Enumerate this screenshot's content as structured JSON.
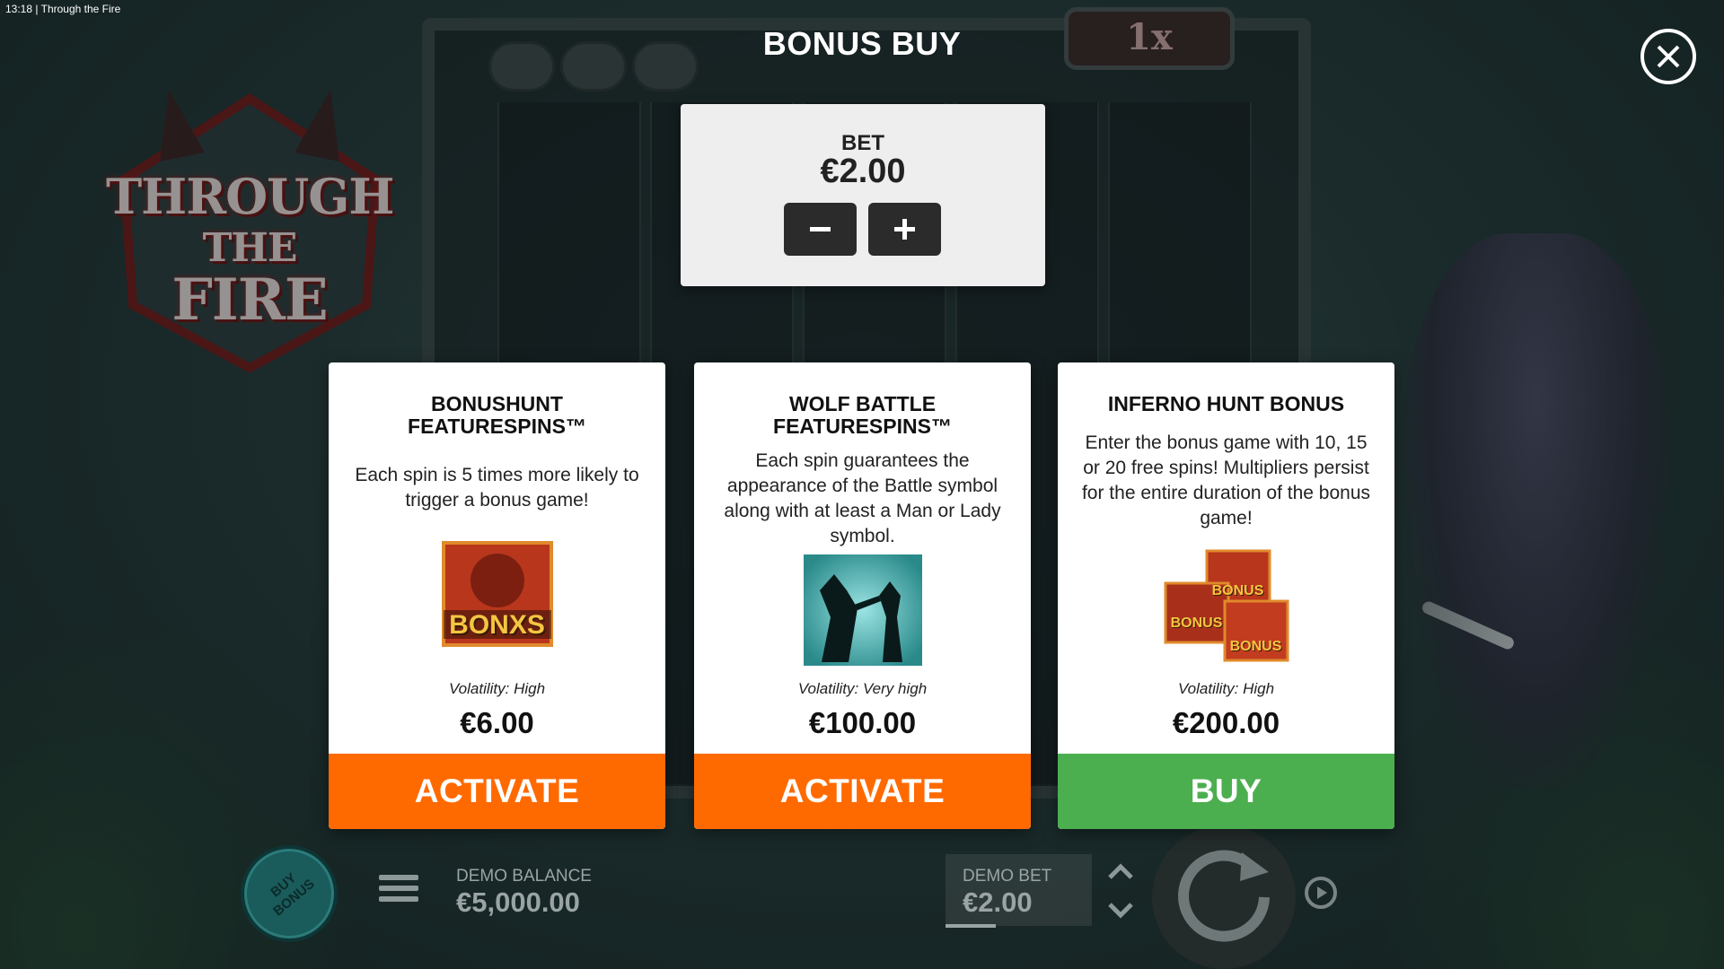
{
  "status": {
    "time": "13:18",
    "separator": "|",
    "title": "Through the Fire"
  },
  "logo": {
    "line1": "THROUGH",
    "line2": "THE",
    "line3": "FIRE"
  },
  "multiplier": "1x",
  "modal": {
    "title": "BONUS BUY",
    "close_icon": "close-icon",
    "bet": {
      "label": "BET",
      "value": "€2.00",
      "decrease_icon": "minus-icon",
      "increase_icon": "plus-icon"
    },
    "cards": [
      {
        "title_line1": "BONUSHUNT",
        "title_line2": "FEATURESPINS™",
        "description": "Each spin is 5 times more likely to trigger a bonus game!",
        "volatility": "Volatility: High",
        "price": "€6.00",
        "action": "ACTIVATE",
        "action_color": "#ff6a00",
        "image_text": "BONXS"
      },
      {
        "title_line1": "WOLF BATTLE",
        "title_line2": "FEATURESPINS™",
        "description": "Each spin guarantees the appearance of the Battle symbol along with at least a Man or Lady symbol.",
        "volatility": "Volatility: Very high",
        "price": "€100.00",
        "action": "ACTIVATE",
        "action_color": "#ff6a00"
      },
      {
        "title_line1": "INFERNO HUNT BONUS",
        "title_line2": "",
        "description": "Enter the bonus game with 10, 15 or 20 free spins! Multipliers persist for the entire duration of the bonus game!",
        "volatility": "Volatility: High",
        "price": "€200.00",
        "action": "BUY",
        "action_color": "#4caf4f",
        "image_text": "BONUS"
      }
    ]
  },
  "bottom_bar": {
    "buy_bonus_line1": "BUY",
    "buy_bonus_line2": "BONUS",
    "balance_label": "DEMO BALANCE",
    "balance_value": "€5,000.00",
    "bet_label": "DEMO BET",
    "bet_value": "€2.00"
  },
  "colors": {
    "accent_orange": "#ff6a00",
    "accent_green": "#4caf4f",
    "panel": "#eeeeee"
  }
}
